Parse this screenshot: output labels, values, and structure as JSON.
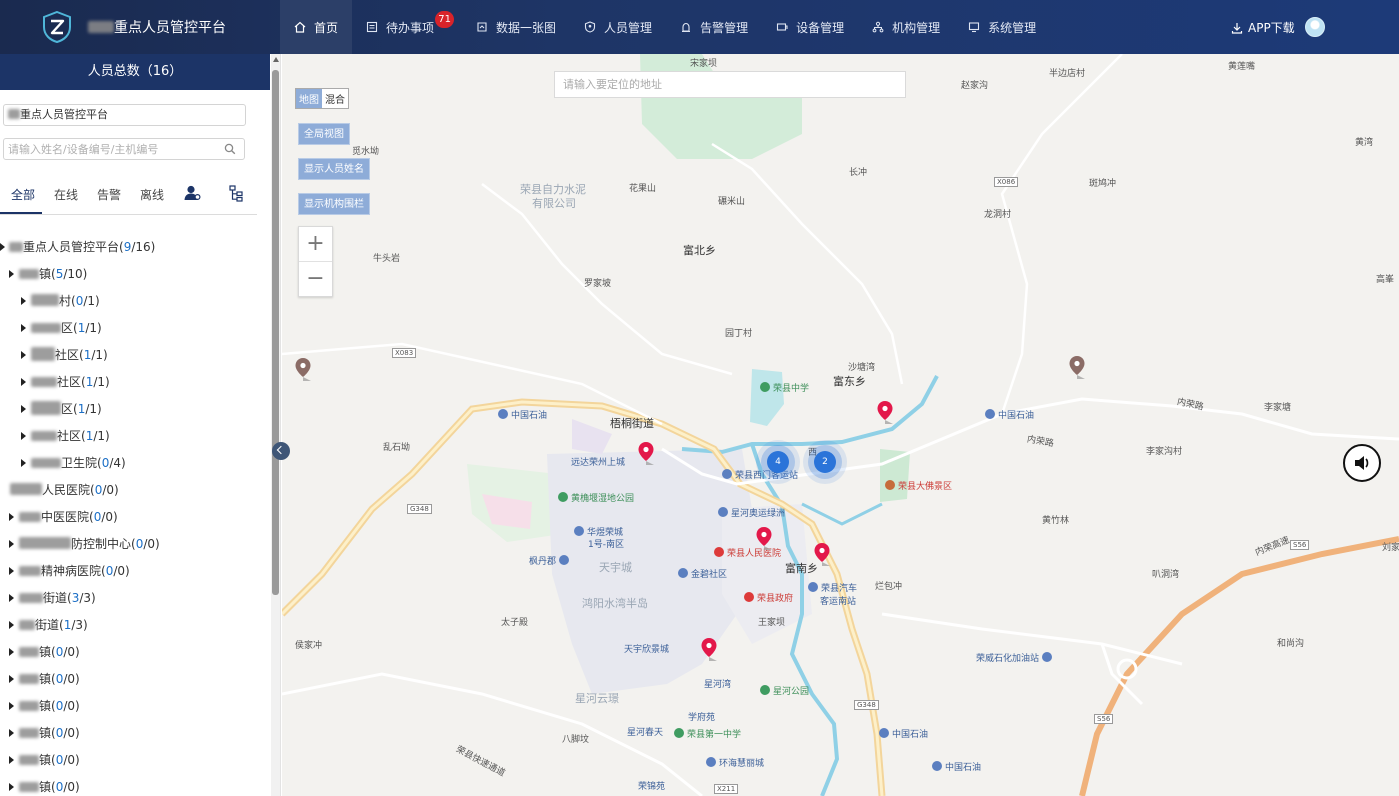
{
  "header": {
    "title_suffix": "重点人员管控平台",
    "nav": [
      {
        "label": "首页",
        "icon": "home-icon",
        "active": true
      },
      {
        "label": "待办事项",
        "icon": "todo-icon",
        "badge": "71"
      },
      {
        "label": "数据一张图",
        "icon": "data-map-icon"
      },
      {
        "label": "人员管理",
        "icon": "shield-user-icon"
      },
      {
        "label": "告警管理",
        "icon": "alarm-icon"
      },
      {
        "label": "设备管理",
        "icon": "device-icon"
      },
      {
        "label": "机构管理",
        "icon": "org-icon"
      },
      {
        "label": "系统管理",
        "icon": "monitor-icon"
      }
    ],
    "app_download": "APP下载"
  },
  "sidebar": {
    "title": "人员总数（16）",
    "org_field_suffix": "重点人员管控平台",
    "search_placeholder": "请输入姓名/设备编号/主机编号",
    "tabs": [
      "全部",
      "在线",
      "告警",
      "离线"
    ],
    "tree": [
      {
        "suffix": "重点人员管控平台(",
        "online": "9",
        "total": "/16)"
      },
      {
        "suffix": "镇(",
        "online": "5",
        "total": "/10)"
      },
      {
        "suffix": "村(",
        "online": "0",
        "total": "/1)"
      },
      {
        "suffix": "区(",
        "online": "1",
        "total": "/1)"
      },
      {
        "suffix": "社区(",
        "online": "1",
        "total": "/1)"
      },
      {
        "suffix": "社区(",
        "online": "1",
        "total": "/1)"
      },
      {
        "suffix": "区(",
        "online": "1",
        "total": "/1)"
      },
      {
        "suffix": "社区(",
        "online": "1",
        "total": "/1)"
      },
      {
        "suffix": "卫生院(",
        "online": "0",
        "total": "/4)"
      },
      {
        "suffix": "人民医院(",
        "online": "0",
        "total": "/0)"
      },
      {
        "suffix": "中医医院(",
        "online": "0",
        "total": "/0)"
      },
      {
        "suffix": "防控制中心(",
        "online": "0",
        "total": "/0)"
      },
      {
        "suffix": "精神病医院(",
        "online": "0",
        "total": "/0)"
      },
      {
        "suffix": "街道(",
        "online": "3",
        "total": "/3)"
      },
      {
        "suffix": "街道(",
        "online": "1",
        "total": "/3)"
      },
      {
        "suffix": "镇(",
        "online": "0",
        "total": "/0)"
      },
      {
        "suffix": "镇(",
        "online": "0",
        "total": "/0)"
      },
      {
        "suffix": "镇(",
        "online": "0",
        "total": "/0)"
      },
      {
        "suffix": "镇(",
        "online": "0",
        "total": "/0)"
      },
      {
        "suffix": "镇(",
        "online": "0",
        "total": "/0)"
      },
      {
        "suffix": "镇(",
        "online": "0",
        "total": "/0)"
      }
    ]
  },
  "map": {
    "search_placeholder": "请输入要定位的地址",
    "type_map": "地图",
    "type_hybrid": "混合",
    "btn_overview": "全局视图",
    "btn_show_names": "显示人员姓名",
    "btn_show_fence": "显示机构围栏",
    "clusters": [
      "4",
      "2"
    ],
    "labels": [
      "宋家坝",
      "赵家沟",
      "半边店村",
      "黄莲嘴",
      "觅水坳",
      "荣县自力水泥",
      "有限公司",
      "花果山",
      "碾米山",
      "长冲",
      "斑鸠冲",
      "龙洞村",
      "黄湾",
      "富北乡",
      "牛头岩",
      "罗家坡",
      "园丁村",
      "高峯",
      "沙塘湾",
      "荣县中学",
      "富东乡",
      "中国石油",
      "梧桐街道",
      "内荣路",
      "李家塘",
      "中国石油",
      "乱石坳",
      "远达荣州上城",
      "荣县西门客运站",
      "西",
      "荣县大佛景区",
      "内荣路",
      "李家沟村",
      "黄桷堰湿地公园",
      "华煜荣城",
      "1号-南区",
      "星河奥运绿洲",
      "黄竹林",
      "荣县人民医院",
      "枫丹郡",
      "天宇城",
      "金碧社区",
      "富南乡",
      "荣县汽车",
      "客运南站",
      "荣县政府",
      "烂包冲",
      "鸿阳水湾半岛",
      "内荣高速",
      "叭洞湾",
      "刘家",
      "太子殿",
      "王家坝",
      "侯家冲",
      "天宇欣景城",
      "和尚沟",
      "荣威石化加油站",
      "星河湾",
      "星河公园",
      "星河云璟",
      "学府苑",
      "八脚坟",
      "星河春天",
      "荣县第一中学",
      "中国石油",
      "荣县快速通道",
      "环海慧丽城",
      "中国石油",
      "荣锦苑"
    ],
    "road_shields": [
      "X086",
      "X083",
      "G348",
      "S56",
      "G348",
      "S56",
      "X211"
    ]
  }
}
